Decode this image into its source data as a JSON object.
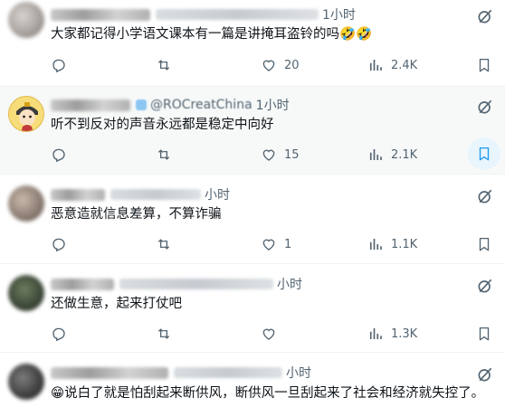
{
  "tweets": [
    {
      "time": "1小时",
      "text": "大家都记得小学语文课本有一篇是讲掩耳盗铃的吗",
      "emoji": "🤣🤣",
      "replies": "",
      "reposts": "",
      "likes": "20",
      "views": "2.4K"
    },
    {
      "handle": "@ROCreatChina",
      "time": "1小时",
      "text": "听不到反对的声音永远都是稳定中向好",
      "likes": "15",
      "views": "2.1K",
      "bookmarked": true
    },
    {
      "time": "小时",
      "text": "恶意造就信息差算，不算诈骗",
      "likes": "1",
      "views": "1.1K"
    },
    {
      "time": "小时",
      "text": "还做生意，起来打仗吧",
      "likes": "",
      "views": "1.3K"
    },
    {
      "time": "小时",
      "emoji": "😁",
      "text": "说白了就是怕刮起来断供风，断供风一旦刮起来了社会和经济就失控了。"
    }
  ],
  "icons": [
    "reply-icon",
    "repost-icon",
    "like-icon",
    "views-icon",
    "bookmark-icon",
    "grok-icon"
  ],
  "colors": {
    "accent": "#1d9bf0",
    "muted": "#536471",
    "text": "#0f1419",
    "hover_bg": "#f7f9f9"
  }
}
